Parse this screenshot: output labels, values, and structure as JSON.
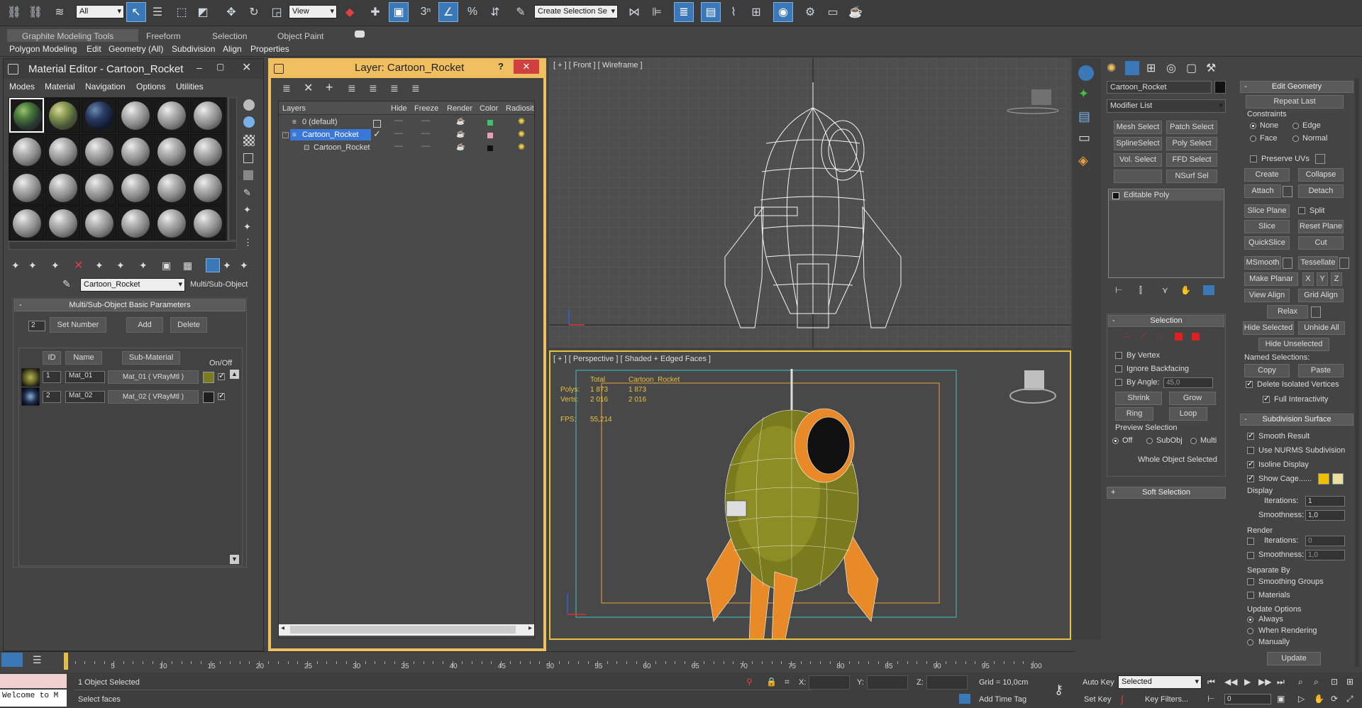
{
  "toolbar": {
    "selection_filter": "All",
    "ref_coord": "View",
    "named_selection_set": "Create Selection Se",
    "icons": [
      "link-icon",
      "unlink-icon",
      "bind-spacewarp-icon",
      "select-object-icon",
      "select-by-name-icon",
      "rect-region-icon",
      "window-crossing-icon",
      "move-icon",
      "rotate-icon",
      "scale-icon",
      "mirror-icon",
      "snap-toggle-icon",
      "angle-snap-icon",
      "percent-snap-icon",
      "spinner-snap-icon",
      "edit-named-sets-icon",
      "align-icon",
      "layer-manager-icon",
      "graphite-toggle-icon",
      "curve-editor-icon",
      "schematic-view-icon",
      "material-editor-icon",
      "render-setup-icon",
      "rendered-frame-icon",
      "render-icon",
      "render-iterative-icon"
    ]
  },
  "ribbon": {
    "tabs": [
      "Graphite Modeling Tools",
      "Freeform",
      "Selection",
      "Object Paint"
    ],
    "sub_tabs": [
      "Polygon Modeling",
      "Edit",
      "Geometry (All)",
      "Subdivision",
      "Align",
      "Properties"
    ]
  },
  "material_editor": {
    "title": "Material Editor - Cartoon_Rocket",
    "menus": [
      "Modes",
      "Material",
      "Navigation",
      "Options",
      "Utilities"
    ],
    "material_name": "Cartoon_Rocket",
    "material_type": "Multi/Sub-Object",
    "rollout_title": "Multi/Sub-Object Basic Parameters",
    "set_number_value": "2",
    "buttons": {
      "set_number": "Set Number",
      "add": "Add",
      "delete": "Delete"
    },
    "columns": {
      "id": "ID",
      "name": "Name",
      "sub_material": "Sub-Material",
      "on_off": "On/Off"
    },
    "rows": [
      {
        "id": "1",
        "name": "Mat_01",
        "sub_material": "Mat_01  ( VRayMtl )",
        "color": "#7a7a1e"
      },
      {
        "id": "2",
        "name": "Mat_02",
        "sub_material": "Mat_02  ( VRayMtl )",
        "color": "#1e1e1e"
      }
    ]
  },
  "layer_manager": {
    "title": "Layer: Cartoon_Rocket",
    "help": "?",
    "columns": [
      "Layers",
      "Hide",
      "Freeze",
      "Render",
      "Color",
      "Radiosit"
    ],
    "rows": [
      {
        "name": "0 (default)",
        "color": "#3fbf6f",
        "indent": 0
      },
      {
        "name": "Cartoon_Rocket",
        "color": "#e8a0b8",
        "indent": 0,
        "selected": true
      },
      {
        "name": "Cartoon_Rocket",
        "color": "#111111",
        "indent": 1
      }
    ]
  },
  "viewports": {
    "front_label": "[ + ] [ Front ] [ Wireframe ]",
    "persp_label": "[ + ] [ Perspective ] [ Shaded + Edged Faces ]",
    "stats": {
      "header_total": "Total",
      "header_name": "Cartoon_Rocket",
      "polys_label": "Polys:",
      "polys_total": "1 873",
      "polys_obj": "1 873",
      "verts_label": "Verts:",
      "verts_total": "2 016",
      "verts_obj": "2 016",
      "fps_label": "FPS:",
      "fps_value": "55,214"
    }
  },
  "command_panel": {
    "object_name": "Cartoon_Rocket",
    "modifier_list": "Modifier List",
    "mod_buttons": [
      "Mesh Select",
      "Patch Select",
      "SplineSelect",
      "Poly Select",
      "Vol. Select",
      "FFD Select",
      "",
      "NSurf Sel"
    ],
    "stack_item": "Editable Poly",
    "selection": {
      "title": "Selection",
      "by_vertex": "By Vertex",
      "ignore_backfacing": "Ignore Backfacing",
      "by_angle": "By Angle:",
      "angle_value": "45,0",
      "shrink": "Shrink",
      "grow": "Grow",
      "ring": "Ring",
      "loop": "Loop",
      "preview_title": "Preview Selection",
      "preview_opts": [
        "Off",
        "SubObj",
        "Multi"
      ],
      "status": "Whole Object Selected"
    },
    "soft_selection": "Soft Selection"
  },
  "edit_geometry": {
    "title": "Edit Geometry",
    "repeat_last": "Repeat Last",
    "constraints": "Constraints",
    "constraint_opts": [
      "None",
      "Edge",
      "Face",
      "Normal"
    ],
    "preserve_uvs": "Preserve UVs",
    "create": "Create",
    "collapse": "Collapse",
    "attach": "Attach",
    "detach": "Detach",
    "slice_plane": "Slice Plane",
    "split": "Split",
    "slice": "Slice",
    "reset_plane": "Reset Plane",
    "quickslice": "QuickSlice",
    "cut": "Cut",
    "msmooth": "MSmooth",
    "tessellate": "Tessellate",
    "make_planar": "Make Planar",
    "x": "X",
    "y": "Y",
    "z": "Z",
    "view_align": "View Align",
    "grid_align": "Grid Align",
    "relax": "Relax",
    "hide_selected": "Hide Selected",
    "unhide_all": "Unhide All",
    "hide_unselected": "Hide Unselected",
    "named_selections": "Named Selections:",
    "copy": "Copy",
    "paste": "Paste",
    "delete_isolated": "Delete Isolated Vertices",
    "full_interactivity": "Full Interactivity"
  },
  "subdivision_surface": {
    "title": "Subdivision Surface",
    "smooth_result": "Smooth Result",
    "use_nurms": "Use NURMS Subdivision",
    "isoline": "Isoline Display",
    "show_cage": "Show Cage......",
    "display": "Display",
    "iterations_label": "Iterations:",
    "display_iterations": "1",
    "smoothness_label": "Smoothness:",
    "display_smoothness": "1,0",
    "render": "Render",
    "render_iterations": "0",
    "render_smoothness": "1,0",
    "separate_by": "Separate By",
    "smoothing_groups": "Smoothing Groups",
    "materials": "Materials",
    "update_options": "Update Options",
    "always": "Always",
    "when_rendering": "When Rendering",
    "manually": "Manually",
    "update": "Update"
  },
  "timeline": {
    "ticks": [
      "5",
      "10",
      "15",
      "20",
      "25",
      "30",
      "35",
      "40",
      "45",
      "50",
      "55",
      "60",
      "65",
      "70",
      "75",
      "80",
      "85",
      "90",
      "95",
      "100"
    ],
    "current_frame": "0"
  },
  "status": {
    "maxscript": "Welcome to M",
    "objects_selected": "1 Object Selected",
    "prompt": "Select faces",
    "x_label": "X:",
    "y_label": "Y:",
    "z_label": "Z:",
    "grid": "Grid = 10,0cm",
    "add_time_tag": "Add Time Tag",
    "auto_key": "Auto Key",
    "set_key": "Set Key",
    "key_mode": "Selected",
    "key_filters": "Key Filters...",
    "frame": "0"
  }
}
